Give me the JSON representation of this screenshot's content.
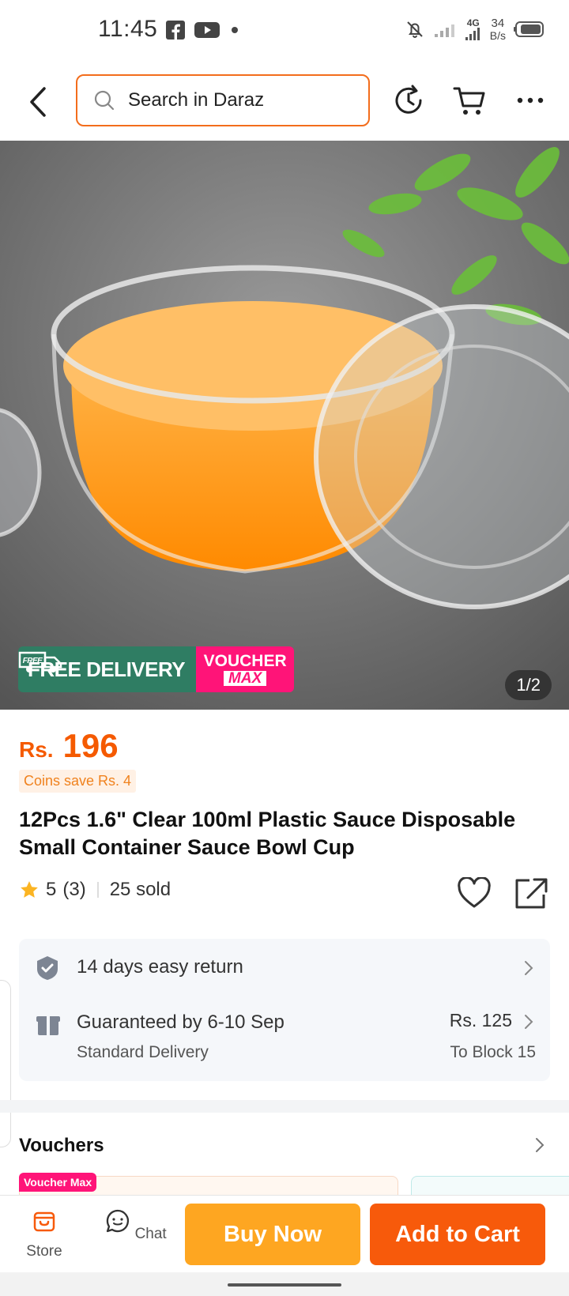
{
  "status_bar": {
    "time": "11:45",
    "network": "4G",
    "speed_value": "34",
    "speed_unit": "B/s"
  },
  "header": {
    "search_placeholder": "Search in Daraz"
  },
  "hero": {
    "free_delivery_small": "FREE",
    "free_delivery_label": "FREE DELIVERY",
    "voucher_line1": "VOUCHER",
    "voucher_line2": "MAX",
    "image_counter": "1/2"
  },
  "product": {
    "currency": "Rs.",
    "price": "196",
    "coins_text": "Coins save Rs. 4",
    "title": "12Pcs 1.6\" Clear 100ml Plastic Sauce Disposable Small Container Sauce Bowl Cup",
    "rating": "5",
    "rating_count": "(3)",
    "sold": "25 sold"
  },
  "services": {
    "return_text": "14 days easy return",
    "delivery_text": "Guaranteed by 6-10 Sep",
    "delivery_sub": "Standard Delivery",
    "delivery_price": "Rs. 125",
    "delivery_location": "To Block 15"
  },
  "vouchers": {
    "title": "Vouchers",
    "tag": "Voucher Max"
  },
  "bottom_bar": {
    "store_label": "Store",
    "chat_label": "Chat",
    "buy_now_label": "Buy Now",
    "add_to_cart_label": "Add to Cart"
  },
  "colors": {
    "accent_orange": "#f75a0b",
    "buy_now_yellow": "#fea621",
    "delivery_green": "#2f7d63",
    "voucher_pink": "#ff1478"
  }
}
